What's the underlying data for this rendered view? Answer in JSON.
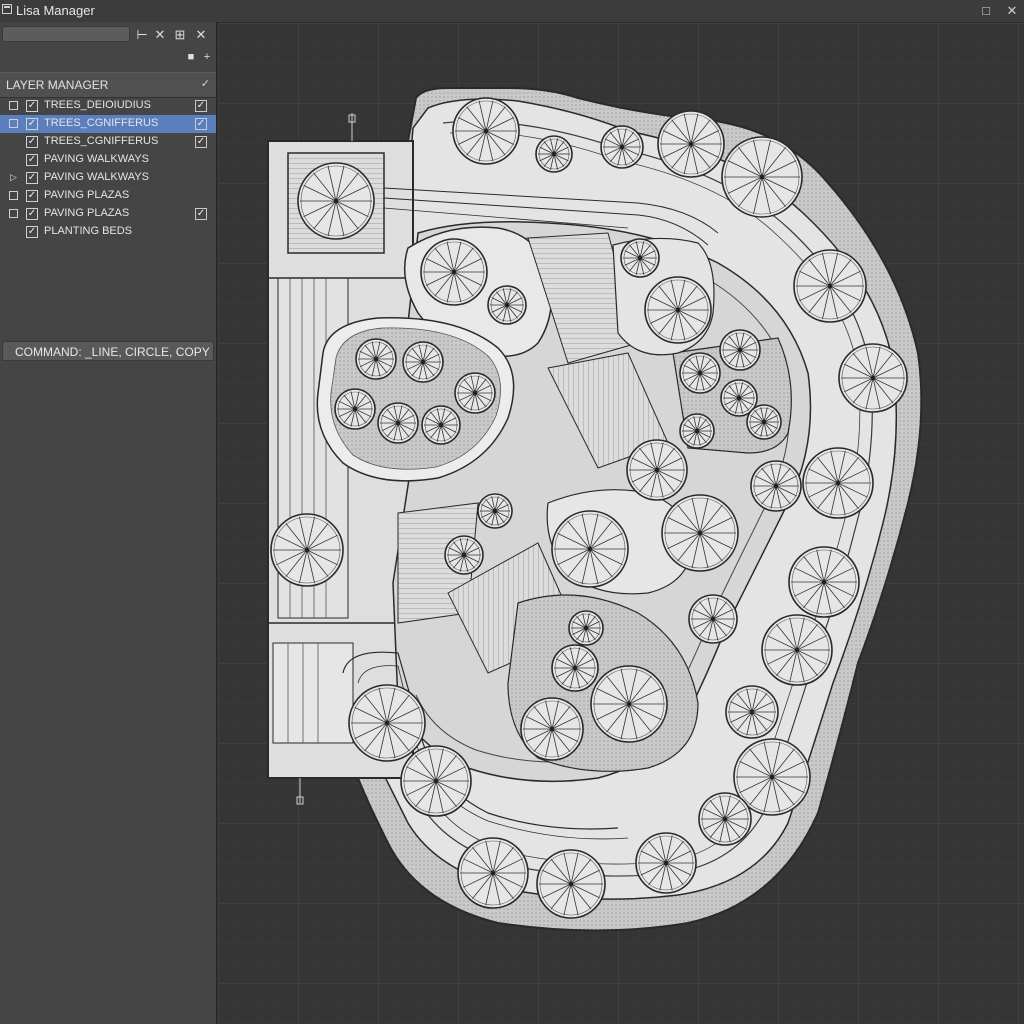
{
  "window": {
    "title": "Lisa Manager",
    "buttons": {
      "restore": "□",
      "close": "✕"
    }
  },
  "toolbar": {
    "search_value": "",
    "pin": "⊢",
    "cut": "✕",
    "dock": "⊞",
    "close": "✕",
    "square": "■",
    "plus": "+"
  },
  "layer_panel": {
    "header": "LAYER MANAGER",
    "header_check": "✓",
    "layers": [
      {
        "name": "TREES_DEIOIUDIUS",
        "expander": "□",
        "visible": true,
        "right_check": true,
        "selected": false
      },
      {
        "name": "TREES_CGNIFFERUS",
        "expander": "□",
        "visible": true,
        "right_check": true,
        "selected": true
      },
      {
        "name": "TREES_CGNIFFERUS",
        "expander": "",
        "visible": true,
        "right_check": true,
        "selected": false
      },
      {
        "name": "PAVING WALKWAYS",
        "expander": "",
        "visible": true,
        "right_check": false,
        "selected": false
      },
      {
        "name": "PAVING WALKWAYS",
        "expander": "▷",
        "visible": true,
        "right_check": false,
        "selected": false
      },
      {
        "name": "PAVING PLAZAS",
        "expander": "□",
        "visible": true,
        "right_check": false,
        "selected": false
      },
      {
        "name": "PAVING PLAZAS",
        "expander": "□",
        "visible": true,
        "right_check": true,
        "selected": false
      },
      {
        "name": "PLANTING BEDS",
        "expander": "",
        "visible": true,
        "right_check": false,
        "selected": false
      }
    ]
  },
  "command_line": {
    "text": "COMMAND: _LINE, CIRCLE, COPY"
  },
  "colors": {
    "accent_selected": "#5a7fbf",
    "canvas_bg": "#353535",
    "plan_fill": "#d9d9d9",
    "plan_stroke": "#2a2a2a",
    "tree_fill": "#e6e6e6"
  },
  "drawing": {
    "tree_count": 46
  }
}
